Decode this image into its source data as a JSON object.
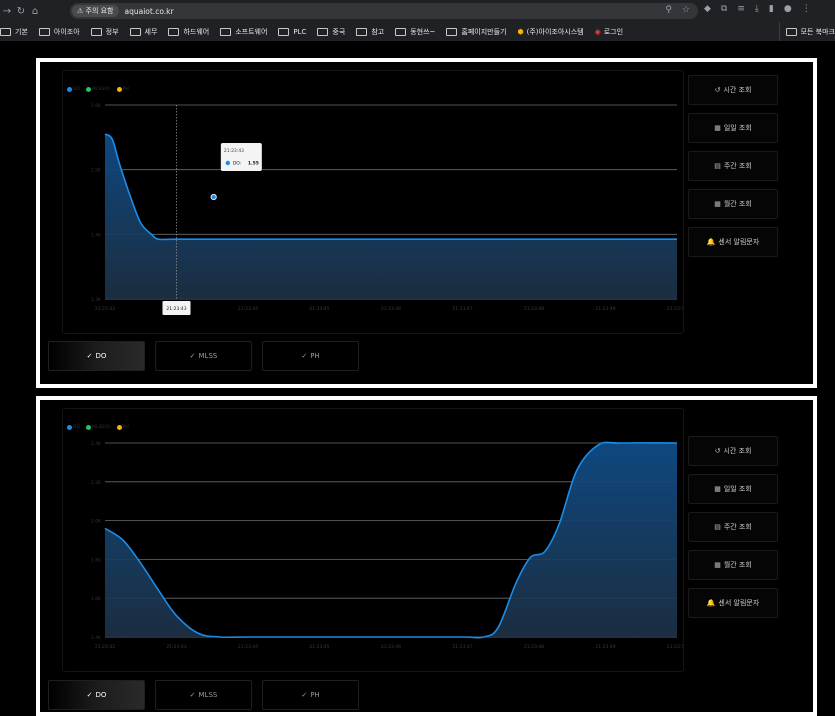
{
  "browser": {
    "warning_label": "주의 요함",
    "url": "aquaiot.co.kr",
    "bookmarks": [
      "기본",
      "아이조아",
      "정부",
      "세무",
      "하드웨어",
      "소프트웨어",
      "PLC",
      "중국",
      "참고",
      "동현쓰~",
      "홈페이지만들기",
      "(주)아이조아시스템",
      "로그인"
    ],
    "bookmarks_right": "모든 북마크"
  },
  "colors": {
    "do": "#1b8ce8",
    "mlss": "#22c55e",
    "ph": "#f6b40a"
  },
  "legend": {
    "do": "DO",
    "mlss": "MLSS(X)",
    "ph": "PH"
  },
  "side_buttons": [
    {
      "icon": "history-icon",
      "glyph": "↺",
      "label": "시간 조회"
    },
    {
      "icon": "calendar-day-icon",
      "glyph": "▦",
      "label": "일일 조회"
    },
    {
      "icon": "calendar-week-icon",
      "glyph": "▤",
      "label": "주간 조회"
    },
    {
      "icon": "calendar-month-icon",
      "glyph": "▦",
      "label": "월간 조회"
    },
    {
      "icon": "bell-icon",
      "glyph": "🔔",
      "label": "센서 알림문자"
    }
  ],
  "toggles": [
    {
      "label": "DO",
      "active": true
    },
    {
      "label": "MLSS",
      "active": false
    },
    {
      "label": "PH",
      "active": false
    }
  ],
  "tooltip": {
    "time": "21:23:43",
    "series": "DO",
    "value": "1.55"
  },
  "crosshair_label": "21:23:43",
  "chart_data": [
    {
      "type": "area",
      "x": [
        "21:23:42",
        "21:23:43",
        "21:23:44",
        "21:23:45",
        "21:23:46",
        "21:23:47",
        "21:23:48",
        "21:23:49",
        "21:23:50"
      ],
      "y_ticks": [
        "1.6K",
        "1.5K",
        "1.4K",
        "1.3K"
      ],
      "ylim": [
        0,
        6
      ],
      "curve": [
        [
          0,
          5.1
        ],
        [
          0.1,
          4.95
        ],
        [
          0.2,
          4.2
        ],
        [
          0.35,
          3.2
        ],
        [
          0.5,
          2.35
        ],
        [
          0.65,
          2.0
        ],
        [
          0.75,
          1.85
        ],
        [
          1.0,
          1.85
        ],
        [
          2,
          1.85
        ],
        [
          3,
          1.85
        ],
        [
          4,
          1.85
        ],
        [
          5,
          1.85
        ],
        [
          6,
          1.85
        ],
        [
          7,
          1.85
        ],
        [
          8,
          1.85
        ]
      ],
      "series": [
        {
          "name": "DO",
          "color": "#1b8ce8"
        }
      ],
      "grid": true
    },
    {
      "type": "area",
      "x": [
        "21:23:42",
        "21:23:43",
        "21:23:44",
        "21:23:45",
        "21:23:46",
        "21:23:47",
        "21:23:48",
        "21:23:49",
        "21:23:50"
      ],
      "y_ticks": [
        "2.4K",
        "2.2K",
        "2.0K",
        "1.8K",
        "1.6K",
        "1.4K"
      ],
      "ylim": [
        0,
        5
      ],
      "curve": [
        [
          0,
          2.8
        ],
        [
          0.25,
          2.5
        ],
        [
          0.5,
          1.9
        ],
        [
          0.75,
          1.2
        ],
        [
          1.0,
          0.55
        ],
        [
          1.3,
          0.1
        ],
        [
          1.6,
          0
        ],
        [
          2,
          0
        ],
        [
          3,
          0
        ],
        [
          4,
          0
        ],
        [
          5,
          0
        ],
        [
          5.3,
          0
        ],
        [
          5.5,
          0.25
        ],
        [
          5.75,
          1.4
        ],
        [
          5.95,
          2.05
        ],
        [
          6.15,
          2.2
        ],
        [
          6.35,
          2.9
        ],
        [
          6.6,
          4.3
        ],
        [
          6.9,
          4.95
        ],
        [
          7.2,
          5.0
        ],
        [
          8,
          5.0
        ]
      ],
      "series": [
        {
          "name": "DO",
          "color": "#1b8ce8"
        }
      ],
      "grid": true
    }
  ]
}
